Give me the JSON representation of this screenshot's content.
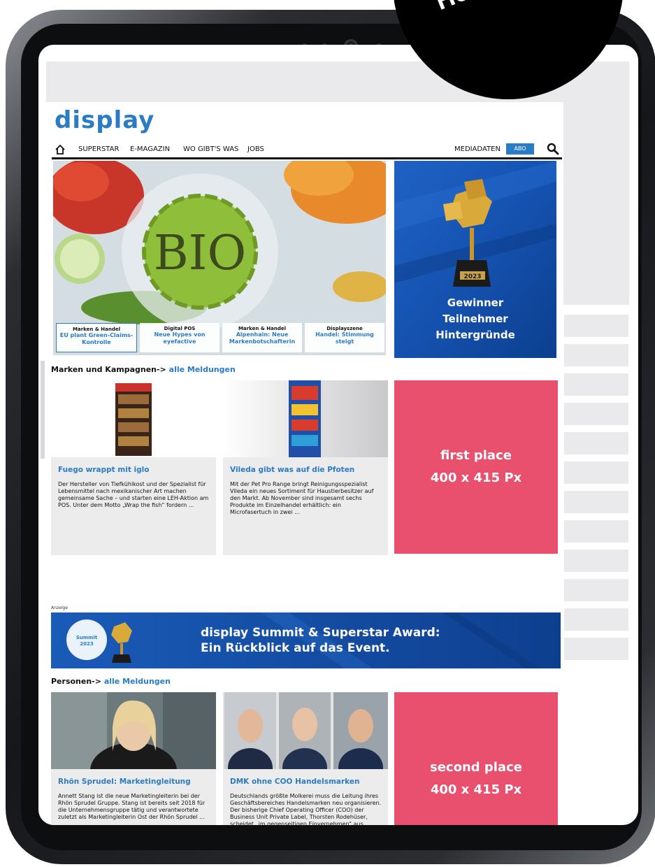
{
  "badge": {
    "label": "Hom"
  },
  "site": {
    "logo": "display",
    "nav": {
      "items": [
        "SUPERSTAR",
        "E-MAGAZIN",
        "WO GIBT'S WAS",
        "JOBS"
      ],
      "mediadaten": "MEDIADATEN",
      "abo": "ABO"
    },
    "hero": {
      "image_text": "BIO",
      "teasers": [
        {
          "category": "Marken & Handel",
          "title": "EU plant Green-Claims-Kontrolle"
        },
        {
          "category": "Digital POS",
          "title": "Neue Hypes von eyefactive"
        },
        {
          "category": "Marken & Handel",
          "title": "Alpenhain: Neue Markenbotschafterin"
        },
        {
          "category": "Displayszene",
          "title": "Handel: Stimmung steigt"
        }
      ]
    },
    "award_ad": {
      "year": "2023",
      "lines": [
        "Gewinner",
        "Teilnehmer",
        "Hintergründe"
      ]
    },
    "section1": {
      "heading": "Marken und Kampagnen->",
      "link": "alle Meldungen",
      "cards": [
        {
          "title": "Fuego wrappt mit iglo",
          "text": "Der Hersteller von Tiefkühlkost und der Spezialist für Lebensmittel nach mexikanischer Art machen gemeinsame Sache – und starten eine LEH-Aktion am POS. Unter dem Motto „Wrap the fish“ fordern ..."
        },
        {
          "title": "Vileda gibt was auf die Pfoten",
          "text": "Mit der Pet Pro Range bringt Reinigungsspezialist Vileda ein neues Sortiment für Haustierbesitzer auf den Markt. Ab November sind insgesamt sechs Produkte im Einzelhandel erhältlich: ein Microfasertuch in zwei ..."
        }
      ],
      "place": {
        "title": "first place",
        "size": "400 x 415 Px"
      }
    },
    "anzeige": "Anzeige",
    "summit_banner": {
      "badge_name": "Summit",
      "badge_year": "2023",
      "lines": [
        "display Summit & Superstar Award:",
        "Ein Rückblick auf das Event."
      ]
    },
    "section2": {
      "heading": "Personen->",
      "link": "alle Meldungen",
      "cards": [
        {
          "title": "Rhön Sprudel: Marketingleitung",
          "text": "Annett Stang ist die neue Marketingleiterin bei der Rhön Sprudel Gruppe. Stang ist bereits seit 2018 für die Unternehmensgruppe tätig und verantwortete zuletzt als Marketingleiterin Ost der Rhön Sprudel ..."
        },
        {
          "title": "DMK ohne COO Handelsmarken",
          "text": "Deutschlands größte Molkerei muss die Leitung ihres Geschäftsbereiches Handelsmarken neu organisieren. Der bisherige Chief Operating Officer (COO) der Business Unit Private Label, Thorsten Rodehüser, scheidet „im gegenseitigen Einvernehmen“ aus ..."
        }
      ],
      "place": {
        "title": "second place",
        "size": "400 x 415 Px"
      }
    }
  },
  "colors": {
    "brand_blue": "#2a7cc4",
    "placement_pink": "#e8506e",
    "placeholder_gray": "#eaeaec",
    "award_navy": "#0f3b86"
  }
}
